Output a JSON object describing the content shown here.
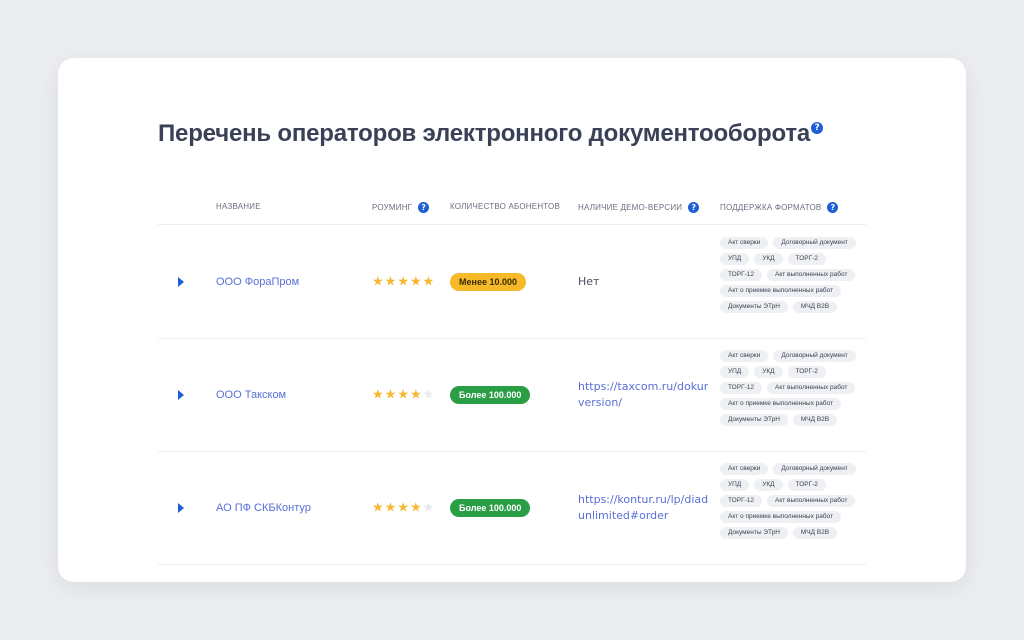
{
  "title": "Перечень операторов электронного документооборота",
  "help_glyph": "?",
  "columns": {
    "name": "Название",
    "roaming": "Роуминг",
    "subscribers": "Количество абонентов",
    "demo": "Наличие демо-версии",
    "formats": "Поддержка форматов"
  },
  "colors": {
    "accent": "#1f5fd6",
    "link": "#5a6fd8",
    "star": "#f5b82e",
    "badge_yellow": "#f6b928",
    "badge_green": "#2a9e45"
  },
  "icons": {
    "expand": "caret-right-icon",
    "help": "question-circle-icon",
    "star": "star-icon"
  },
  "rows": [
    {
      "name": "ООО ФораПром",
      "rating": 5,
      "subscribers": "Менее 10.000",
      "badge": "yellow",
      "demo_type": "text",
      "demo_lines": [
        "Нет"
      ],
      "formats": [
        "Акт сверки",
        "Договорный документ",
        "УПД",
        "УКД",
        "ТОРГ-2",
        "ТОРГ-12",
        "Акт выполненных работ",
        "Акт о приемке выполненных работ",
        "Документы ЭТрН",
        "МЧД B2B"
      ]
    },
    {
      "name": "ООО Такском",
      "rating": 4,
      "subscribers": "Более 100.000",
      "badge": "green",
      "demo_type": "link",
      "demo_lines": [
        "https://taxcom.ru/dokun",
        "version/"
      ],
      "formats": [
        "Акт сверки",
        "Договорный документ",
        "УПД",
        "УКД",
        "ТОРГ-2",
        "ТОРГ-12",
        "Акт выполненных работ",
        "Акт о приемке выполненных работ",
        "Документы ЭТрН",
        "МЧД B2B"
      ]
    },
    {
      "name": "АО ПФ СКБКонтур",
      "rating": 4,
      "subscribers": "Более 100.000",
      "badge": "green",
      "demo_type": "link",
      "demo_lines": [
        "https://kontur.ru/lp/diad",
        "unlimited#order"
      ],
      "formats": [
        "Акт сверки",
        "Договорный документ",
        "УПД",
        "УКД",
        "ТОРГ-2",
        "ТОРГ-12",
        "Акт выполненных работ",
        "Акт о приемке выполненных работ",
        "Документы ЭТрН",
        "МЧД B2B"
      ]
    }
  ]
}
